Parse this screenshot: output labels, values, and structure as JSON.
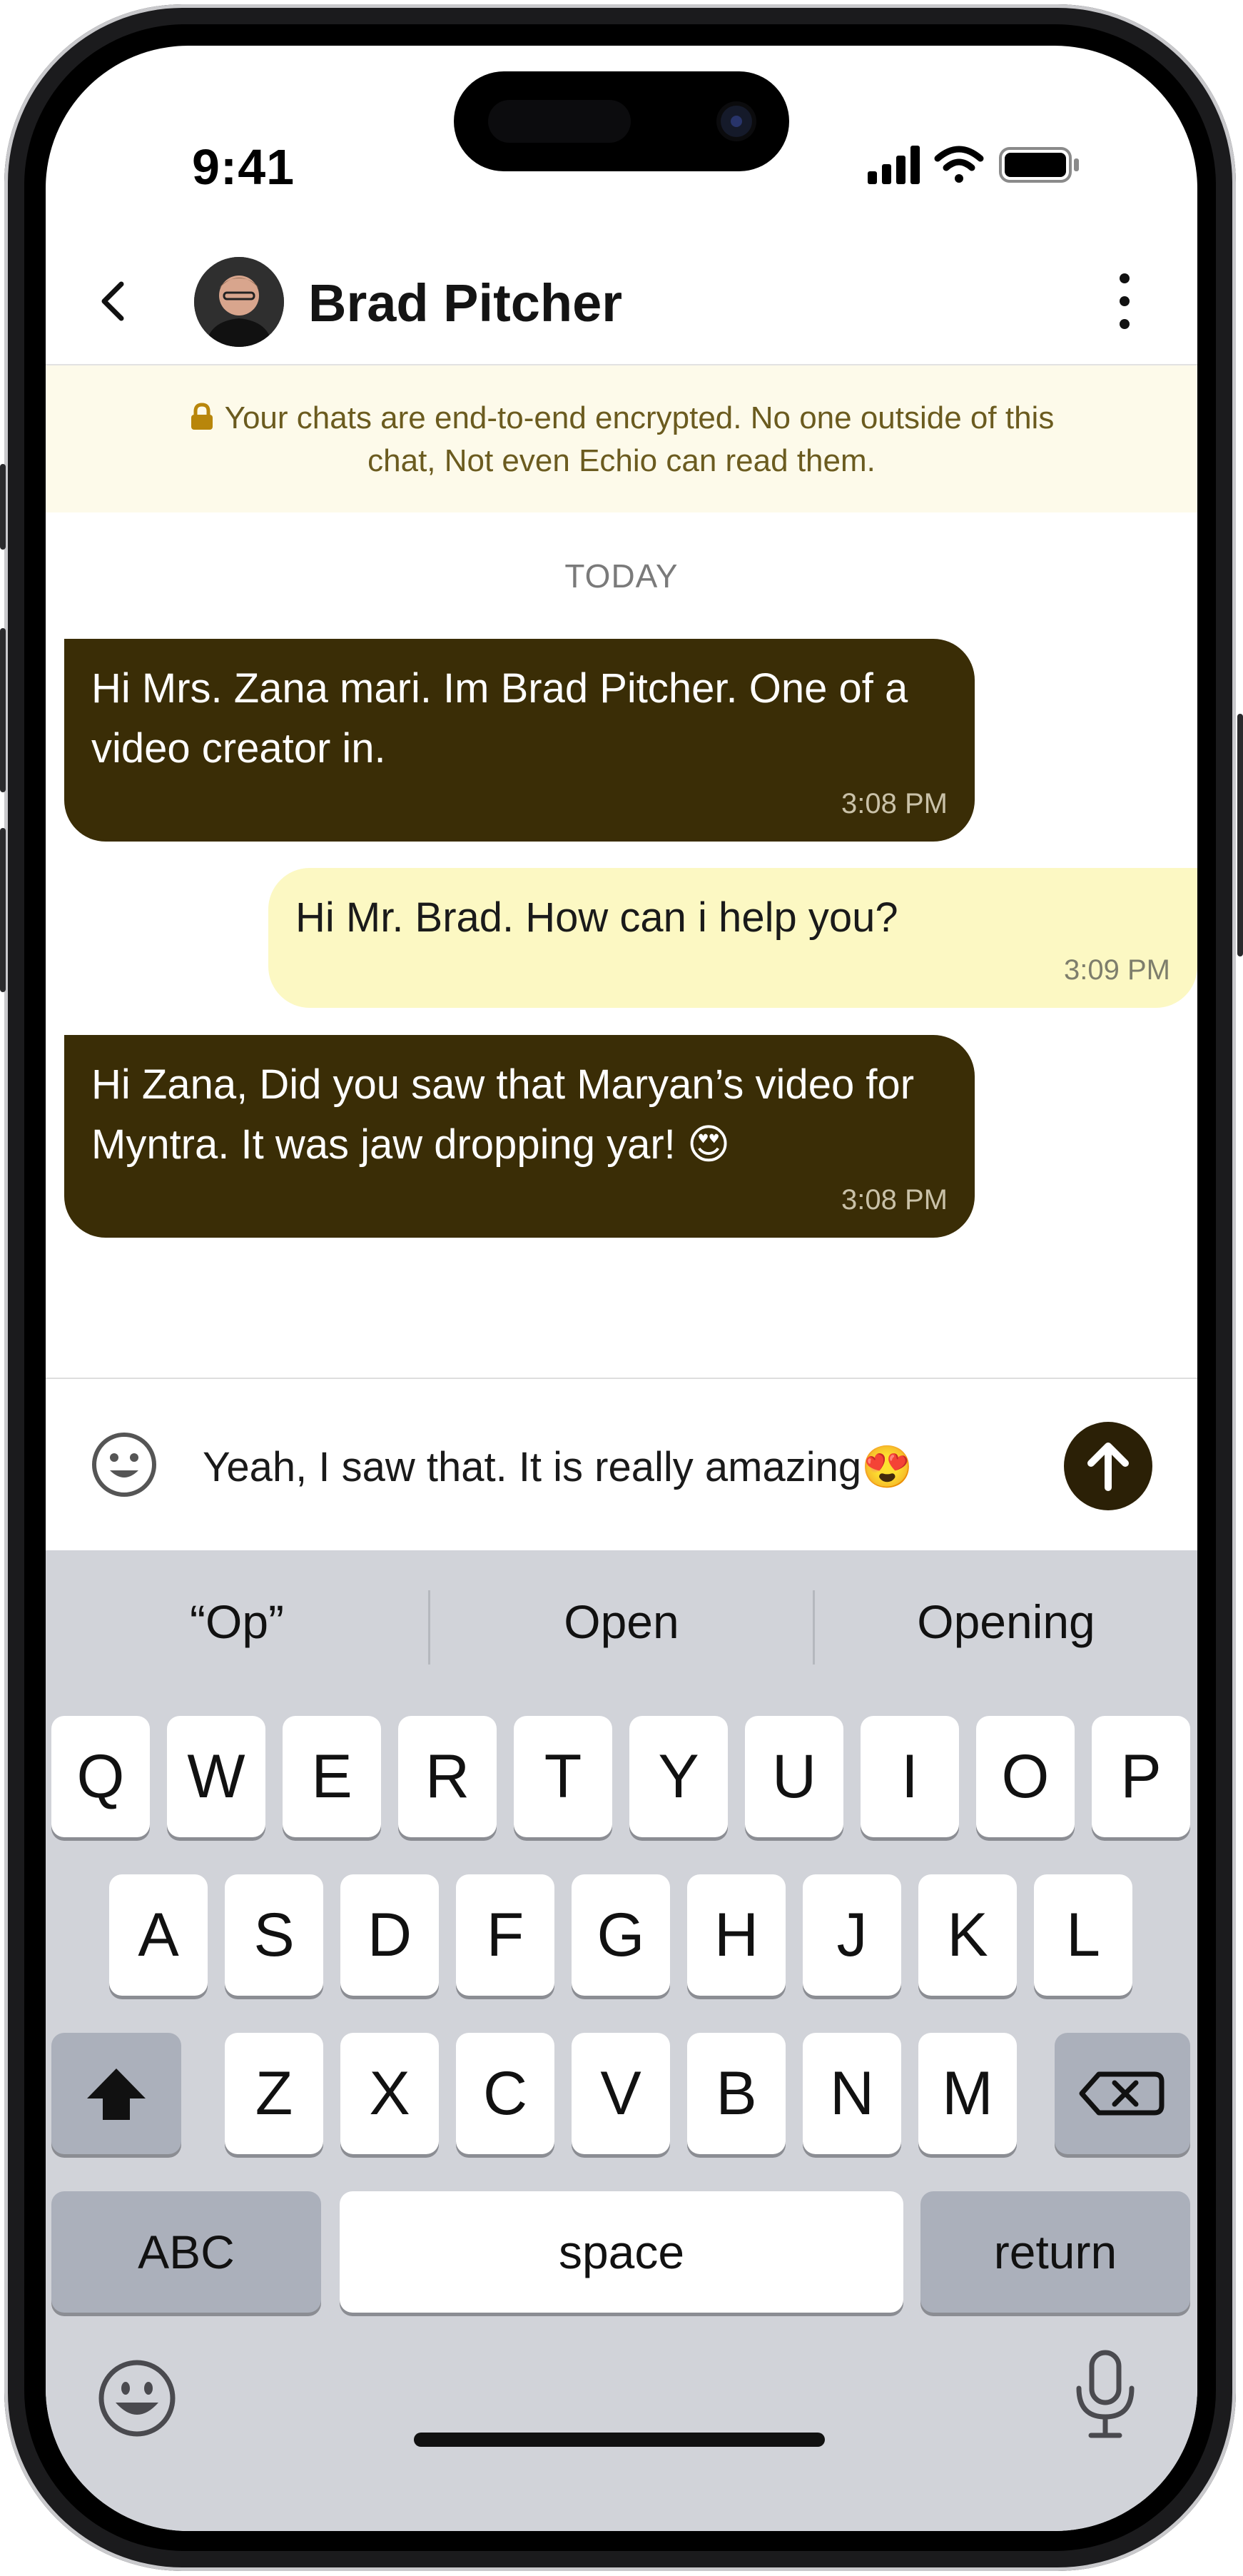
{
  "status_bar": {
    "time": "9:41"
  },
  "header": {
    "contact_name": "Brad Pitcher",
    "back_icon": "chevron-left-icon",
    "menu_icon": "more-vertical-icon"
  },
  "banner": {
    "icon": "lock-icon",
    "text": "Your chats are end-to-end encrypted. No one outside of this chat, Not even Echio can read them."
  },
  "conversation": {
    "date_label": "TODAY",
    "messages": [
      {
        "direction": "incoming",
        "text": "Hi Mrs. Zana mari. Im Brad Pitcher. One of a video creator in.",
        "time": "3:08 PM"
      },
      {
        "direction": "outgoing",
        "text": "Hi Mr. Brad. How can i help you?",
        "time": "3:09 PM"
      },
      {
        "direction": "incoming",
        "text": "Hi Zana, Did you saw that Maryan’s video for Myntra. It was jaw dropping yar! 😍",
        "time": "3:08 PM"
      }
    ]
  },
  "composer": {
    "value": "Yeah, I saw that. It is really amazing😍",
    "emoji_icon": "smiley-icon",
    "send_icon": "arrow-up-icon"
  },
  "keyboard": {
    "suggestions": [
      "“Op”",
      "Open",
      "Opening"
    ],
    "row1": [
      "Q",
      "W",
      "E",
      "R",
      "T",
      "Y",
      "U",
      "I",
      "O",
      "P"
    ],
    "row2": [
      "A",
      "S",
      "D",
      "F",
      "G",
      "H",
      "J",
      "K",
      "L"
    ],
    "row3": [
      "Z",
      "X",
      "C",
      "V",
      "B",
      "N",
      "M"
    ],
    "abc_label": "ABC",
    "space_label": "space",
    "return_label": "return"
  },
  "colors": {
    "incoming_bubble": "#3a2d06",
    "outgoing_bubble": "#fcf8c3",
    "banner_bg": "#fdfaea",
    "send_button": "#2b2006",
    "keyboard_bg": "#d1d3d9"
  }
}
